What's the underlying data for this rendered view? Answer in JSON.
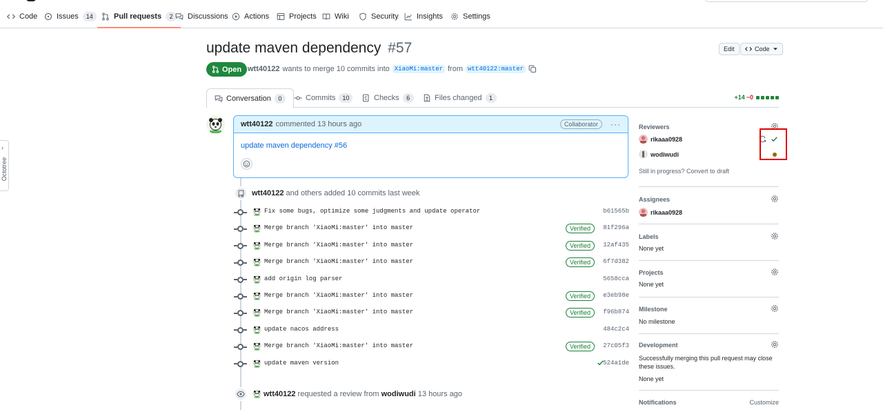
{
  "nav": {
    "items": [
      {
        "label": "Code",
        "icon": "code-icon"
      },
      {
        "label": "Issues",
        "count": "14",
        "icon": "issue-icon"
      },
      {
        "label": "Pull requests",
        "count": "2",
        "icon": "pull-request-icon"
      },
      {
        "label": "Discussions",
        "icon": "discussion-icon"
      },
      {
        "label": "Actions",
        "icon": "play-icon"
      },
      {
        "label": "Projects",
        "icon": "table-icon"
      },
      {
        "label": "Wiki",
        "icon": "book-icon"
      },
      {
        "label": "Security",
        "icon": "shield-icon"
      },
      {
        "label": "Insights",
        "icon": "graph-icon"
      },
      {
        "label": "Settings",
        "icon": "gear-icon"
      }
    ],
    "active": "Pull requests"
  },
  "octotree": {
    "label": "Octotree"
  },
  "pr": {
    "title": "update maven dependency",
    "number": "#57",
    "edit_label": "Edit",
    "code_label": "Code",
    "state": "Open",
    "author": "wtt40122",
    "merge_text": "wants to merge 10 commits into",
    "base_branch": "XiaoMi:master",
    "from_text": "from",
    "head_branch": "wtt40122:master"
  },
  "tabs": [
    {
      "label": "Conversation",
      "count": "0"
    },
    {
      "label": "Commits",
      "count": "10"
    },
    {
      "label": "Checks",
      "count": "6"
    },
    {
      "label": "Files changed",
      "count": "1"
    }
  ],
  "diffstat": {
    "additions": "+14",
    "deletions": "−0"
  },
  "comment": {
    "author": "wtt40122",
    "time": "commented 13 hours ago",
    "badge": "Collaborator",
    "body_link": "update maven dependency #56"
  },
  "commits_event": {
    "author": "wtt40122",
    "text": "and others added 10 commits last week"
  },
  "commits": [
    {
      "message": "Fix some bugs, optimize some judgments and update operator",
      "verified": "",
      "sha": "b61565b",
      "check": false
    },
    {
      "message": "Merge branch 'XiaoMi:master' into master",
      "verified": "Verified",
      "sha": "81f296a",
      "check": false
    },
    {
      "message": "Merge branch 'XiaoMi:master' into master",
      "verified": "Verified",
      "sha": "12af435",
      "check": false
    },
    {
      "message": "Merge branch 'XiaoMi:master' into master",
      "verified": "Verified",
      "sha": "6f7d382",
      "check": false
    },
    {
      "message": "add origin log parser",
      "verified": "",
      "sha": "5658cca",
      "check": false
    },
    {
      "message": "Merge branch 'XiaoMi:master' into master",
      "verified": "Verified",
      "sha": "e3eb98e",
      "check": false
    },
    {
      "message": "Merge branch 'XiaoMi:master' into master",
      "verified": "Verified",
      "sha": "f96b874",
      "check": false
    },
    {
      "message": "update nacos address",
      "verified": "",
      "sha": "484c2c4",
      "check": false
    },
    {
      "message": "Merge branch 'XiaoMi:master' into master",
      "verified": "Verified",
      "sha": "27c05f3",
      "check": false
    },
    {
      "message": "update maven version",
      "verified": "",
      "sha": "524a1de",
      "check": true
    }
  ],
  "review_event": {
    "author": "wtt40122",
    "text": "requested a review from",
    "reviewer": "wodiwudi",
    "time": "13 hours ago"
  },
  "sidebar": {
    "reviewers": {
      "title": "Reviewers",
      "users": [
        {
          "name": "rikaaa0928",
          "status": "approved"
        },
        {
          "name": "wodiwudi",
          "status": "pending"
        }
      ],
      "draft_prefix": "Still in progress?",
      "draft_link": "Convert to draft"
    },
    "assignees": {
      "title": "Assignees",
      "user": "rikaaa0928"
    },
    "labels": {
      "title": "Labels",
      "value": "None yet"
    },
    "projects": {
      "title": "Projects",
      "value": "None yet"
    },
    "milestone": {
      "title": "Milestone",
      "value": "No milestone"
    },
    "development": {
      "title": "Development",
      "text": "Successfully merging this pull request may close these issues.",
      "value": "None yet"
    },
    "notifications": {
      "title": "Notifications",
      "action": "Customize"
    }
  },
  "colors": {
    "open_green": "#1f883d",
    "link_blue": "#0969da",
    "highlight_red": "#e00000",
    "pending_dot": "#9a6700"
  }
}
